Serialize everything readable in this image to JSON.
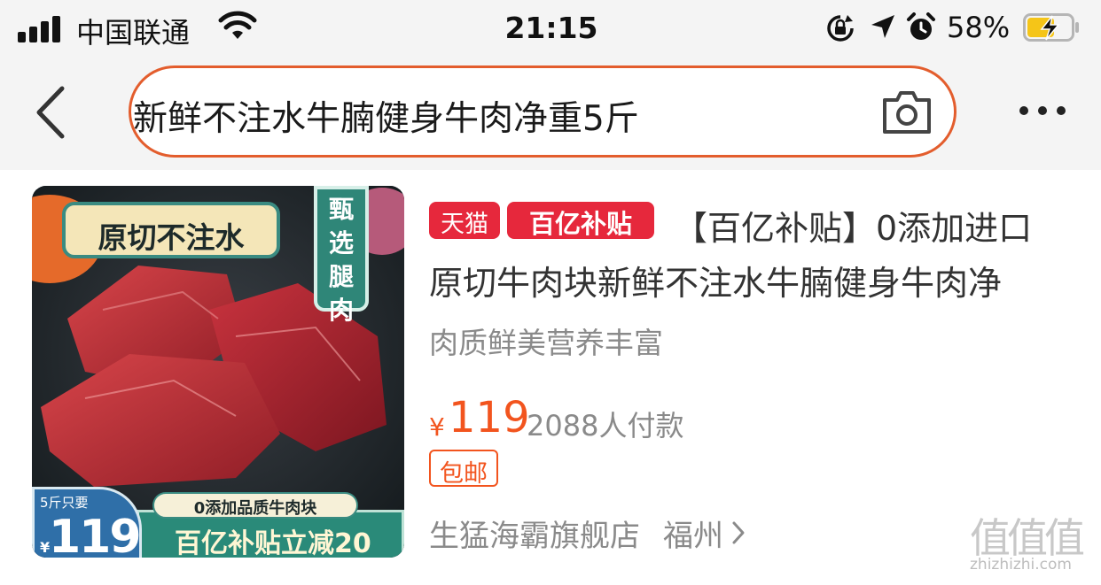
{
  "status_bar": {
    "carrier": "中国联通",
    "time": "21:15",
    "battery_percent": "58%",
    "icons": [
      "signal-icon",
      "wifi-icon",
      "rotation-lock-icon",
      "location-arrow-icon",
      "alarm-icon",
      "battery-charging-icon"
    ]
  },
  "header": {
    "back_icon": "chevron-left-icon",
    "search_query": "新鲜不注水牛腩健身牛肉净重5斤",
    "camera_icon": "camera-icon",
    "more_icon": "more-dots-icon",
    "accent_color": "#e35d2d"
  },
  "product": {
    "image": {
      "badge_top": "原切不注水",
      "badge_side": "甄选腿肉",
      "price_badge_label": "5斤只要",
      "price_badge_yen": "¥",
      "price_badge_value": "119",
      "promo_tag": "0添加品质牛肉块",
      "promo_strip": "百亿补贴立减20"
    },
    "badges": [
      "天猫",
      "百亿补贴"
    ],
    "title_line1": "【百亿补贴】0添加进口",
    "title_line2": "原切牛肉块新鲜不注水牛腩健身牛肉净",
    "subtitle": "肉质鲜美营养丰富",
    "price_symbol": "¥",
    "price": "119",
    "sales": "2088人付款",
    "tag": "包邮",
    "shop_name": "生猛海霸旗舰店",
    "shop_city": "福州",
    "price_color": "#f2541e",
    "badge_color": "#e6283c"
  },
  "watermark": {
    "logo": "值值值",
    "url": "zhizhizhi.com"
  }
}
